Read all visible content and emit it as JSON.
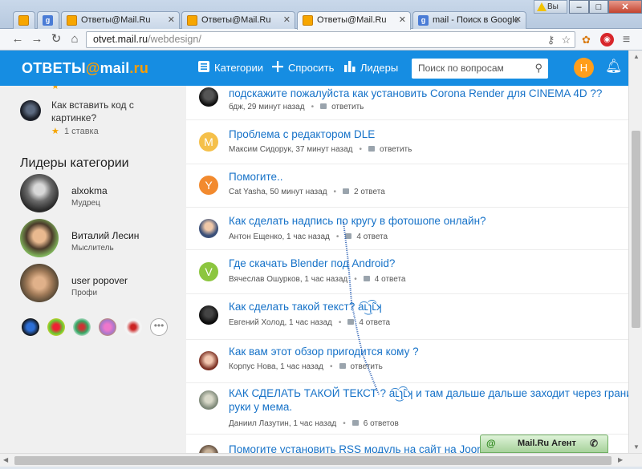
{
  "browser": {
    "tabs": [
      {
        "label": "",
        "favicon": "mail-icon"
      },
      {
        "label": "",
        "favicon": "g-icon"
      },
      {
        "label": "Ответы@Mail.Ru",
        "favicon": "mail-icon"
      },
      {
        "label": "Ответы@Mail.Ru",
        "favicon": "mail-icon"
      },
      {
        "label": "Ответы@Mail.Ru",
        "favicon": "mail-icon"
      },
      {
        "label": "mail - Поиск в Google",
        "favicon": "g-icon"
      }
    ],
    "user_badge": "Вы",
    "url_host": "otvet.mail.ru",
    "url_path": "/webdesign/"
  },
  "header": {
    "logo_prefix": "ОТВЕТЫ",
    "logo_at": "@",
    "logo_suffix": "mail",
    "logo_dot": ".ru",
    "nav": {
      "categories": "Категории",
      "ask": "Спросить",
      "leaders": "Лидеры"
    },
    "search_placeholder": "Поиск по вопросам",
    "avatar_letter": "Н",
    "accent": "#168de2"
  },
  "sidebar": {
    "question": {
      "title": "Как вставить код с картинке?",
      "bets": "1 ставка"
    },
    "leaders_heading": "Лидеры категории",
    "leaders": [
      {
        "name": "alxokma",
        "rank": "Мудрец"
      },
      {
        "name": "Виталий Лесин",
        "rank": "Мыслитель"
      },
      {
        "name": "user popover",
        "rank": "Профи"
      }
    ],
    "more": "•••"
  },
  "feed": [
    {
      "title": "подскажите пожалуйста как установить Corona Render для CINEMA 4D ??",
      "author": "бдж, 29 минут назад",
      "answers": "ответить",
      "avatar_letter": "",
      "avatar_color": "#222222"
    },
    {
      "title": "Проблема с редактором DLE",
      "author": "Максим Сидорук, 37 минут назад",
      "answers": "ответить",
      "avatar_letter": "M",
      "avatar_color": "#f5c04a"
    },
    {
      "title": "Помогите..",
      "author": "Cat Yasha, 50 минут назад",
      "answers": "2 ответа",
      "avatar_letter": "Y",
      "avatar_color": "#f28a2e"
    },
    {
      "title": "Как сделать надпись по кругу в фотошопе онлайн?",
      "author": "Антон Ещенко, 1 час назад",
      "answers": "4 ответа",
      "avatar_letter": "",
      "avatar_color": "#5b7fa8"
    },
    {
      "title": "Где скачать Blender под Android?",
      "author": "Вячеслав Ошурков, 1 час назад",
      "answers": "4 ответа",
      "avatar_letter": "V",
      "avatar_color": "#8cc63f"
    },
    {
      "title": "Как сделать такой текст? a͡ʟ͜ɿ͡ʟ̃ʞ",
      "author": "Евгений Холод, 1 час назад",
      "answers": "4 ответа",
      "avatar_letter": "",
      "avatar_color": "#1a1a1a"
    },
    {
      "title": "Как вам этот обзор пригодится кому ?",
      "author": "Корпус Нова, 1 час назад",
      "answers": "ответить",
      "avatar_letter": "",
      "avatar_color": "#b05a4a"
    },
    {
      "title": "КАК СДЕЛАТЬ ТАКОЙ ТЕКСТ ? a͡ʟ͜ɿ͡ʟ̃ʞ и там дальше дальше заходит через грани",
      "title2": "руки у мема.",
      "author": "Даниил Лазутин, 1 час назад",
      "answers": "6 ответов",
      "avatar_letter": "",
      "avatar_color": "#8f9a8a"
    },
    {
      "title": "Помогите установить RSS модуль на сайт на Joomla",
      "author": "",
      "answers": "",
      "avatar_letter": "",
      "avatar_color": "#7a6a5a"
    }
  ],
  "agent": {
    "label": "Mail.Ru Агент"
  }
}
